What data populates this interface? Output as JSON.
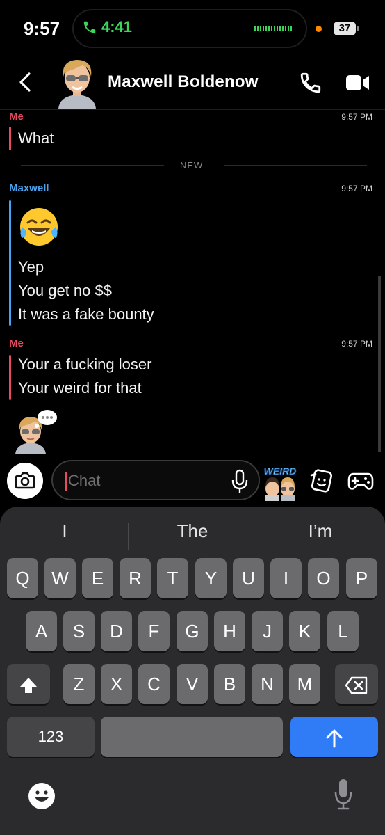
{
  "status_bar": {
    "time": "9:57",
    "call_duration": "4:41",
    "battery": "37",
    "call_color": "#3ad65a"
  },
  "header": {
    "contact_name": "Maxwell Boldenow",
    "back_icon": "chevron-left-icon",
    "call_icon": "phone-icon",
    "video_icon": "video-camera-icon"
  },
  "messages": {
    "divider_label": "NEW",
    "groups": [
      {
        "sender": "Me",
        "time": "9:57 PM",
        "lines": [
          "What"
        ]
      },
      {
        "sender": "Maxwell",
        "time": "9:57 PM",
        "emoji": "face-with-tears-of-joy",
        "lines": [
          "Yep",
          "You get no $$",
          "It was a fake bounty"
        ]
      },
      {
        "sender": "Me",
        "time": "9:57 PM",
        "lines": [
          "Your a fucking loser",
          "Your weird for that"
        ]
      }
    ]
  },
  "input_bar": {
    "placeholder": "Chat",
    "value": "",
    "sticker_text": "WEIRD"
  },
  "keyboard": {
    "suggestions": [
      "I",
      "The",
      "I’m"
    ],
    "row1": [
      "Q",
      "W",
      "E",
      "R",
      "T",
      "Y",
      "U",
      "I",
      "O",
      "P"
    ],
    "row2": [
      "A",
      "S",
      "D",
      "F",
      "G",
      "H",
      "J",
      "K",
      "L"
    ],
    "row3": [
      "Z",
      "X",
      "C",
      "V",
      "B",
      "N",
      "M"
    ],
    "numbers_label": "123",
    "shift_icon": "shift-icon",
    "backspace_icon": "backspace-icon",
    "send_icon": "arrow-up-icon"
  },
  "colors": {
    "me_accent": "#e84a5f",
    "maxwell_accent": "#4aa3f0",
    "send_key": "#2f7cf6"
  }
}
